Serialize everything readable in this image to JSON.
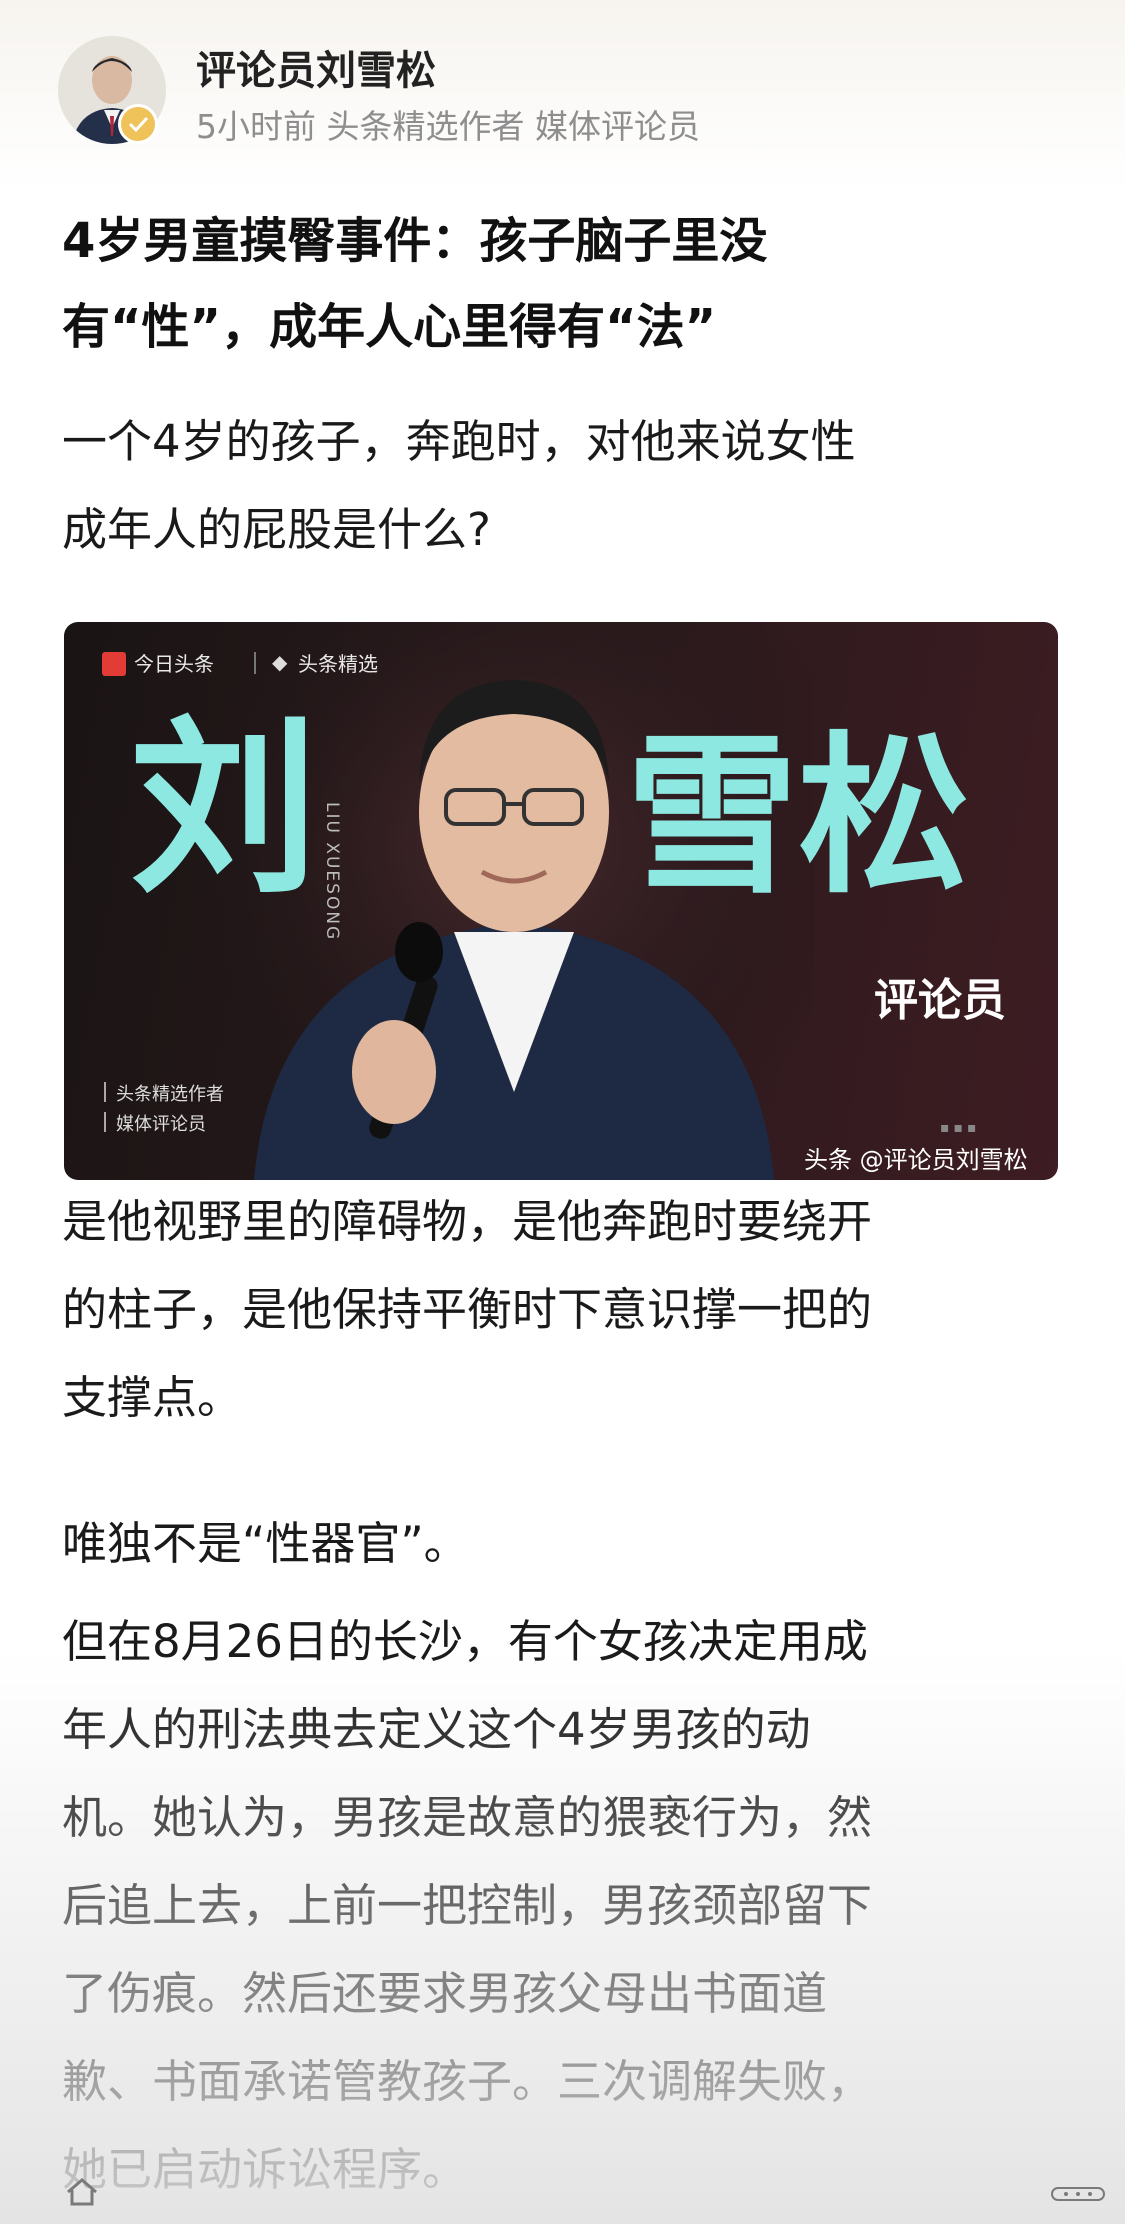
{
  "author": {
    "name": "评论员刘雪松",
    "meta": "5小时前 头条精选作者 媒体评论员"
  },
  "article": {
    "title_line1": "4岁男童摸臀事件：孩子脑子里没",
    "title_line2": "有“性”，成年人心里得有“法”",
    "p1_line1": "一个4岁的孩子，奔跑时，对他来说女性",
    "p1_line2": "成年人的屁股是什么?",
    "p2_line1": "是他视野里的障碍物，是他奔跑时要绕开",
    "p2_line2": "的柱子，是他保持平衡时下意识撑一把的",
    "p2_line3": "支撑点。",
    "p3": "唯独不是“性器官”。",
    "p4_line1": "但在8月26日的长沙，有个女孩决定用成",
    "p4_line2": "年人的刑法典去定义这个4岁男孩的动",
    "p4_line3": "机。她认为，男孩是故意的猥亵行为，然",
    "p4_line4": "后追上去，上前一把控制，男孩颈部留下",
    "p4_line5": "了伤痕。然后还要求男孩父母出书面道",
    "p4_line6": "歉、书面承诺管教孩子。三次调解失败，",
    "p4_line7": "她已启动诉讼程序。"
  },
  "banner": {
    "logo1": "今日头条",
    "logo2": "头条精选",
    "name_part1": "刘",
    "name_part2": "雪松",
    "pinyin": "LIU XUESONG",
    "role": "评论员",
    "tag1": "头条精选作者",
    "tag2": "媒体评论员",
    "watermark": "头条 @评论员刘雪松",
    "accent_color": "#8ee8e2"
  },
  "icons": {
    "home": "home-icon",
    "more": "more-icon"
  }
}
